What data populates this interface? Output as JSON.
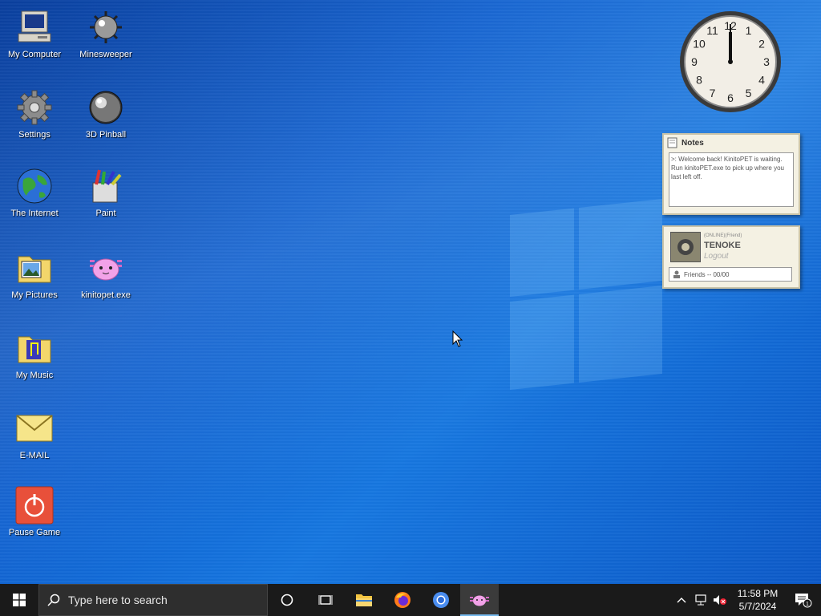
{
  "desktop_icons": [
    {
      "label": "My Computer",
      "icon": "computer-icon"
    },
    {
      "label": "Minesweeper",
      "icon": "mine-icon"
    },
    {
      "label": "Settings",
      "icon": "gear-icon"
    },
    {
      "label": "3D Pinball",
      "icon": "pinball-icon"
    },
    {
      "label": "The Internet",
      "icon": "globe-icon"
    },
    {
      "label": "Paint",
      "icon": "paint-icon"
    },
    {
      "label": "My Pictures",
      "icon": "pictures-folder-icon"
    },
    {
      "label": "kinitopet.exe",
      "icon": "axolotl-icon"
    },
    {
      "label": "My Music",
      "icon": "music-folder-icon"
    },
    {
      "label": "E-MAIL",
      "icon": "mail-icon"
    },
    {
      "label": "Pause Game",
      "icon": "power-icon"
    }
  ],
  "clock_widget": {
    "numbers": [
      "12",
      "1",
      "2",
      "3",
      "4",
      "5",
      "6",
      "7",
      "8",
      "9",
      "10",
      "11"
    ]
  },
  "notes_widget": {
    "title": "Notes",
    "text": ">: Welcome back! KinitoPET is waiting. Run kinitoPET.exe to pick up where you last left off."
  },
  "profile_widget": {
    "status": "(ONLINE)(Friend)",
    "name": "TENOKE",
    "logout": "Logout",
    "friends": "Friends -- 00/00"
  },
  "taskbar": {
    "search_placeholder": "Type here to search",
    "time": "11:58 PM",
    "date": "5/7/2024",
    "notification_count": "1"
  },
  "colors": {
    "taskbar": "#1a1a1a",
    "desktop_blue": "#0d5fd0",
    "active_underline": "#76b9ed"
  }
}
